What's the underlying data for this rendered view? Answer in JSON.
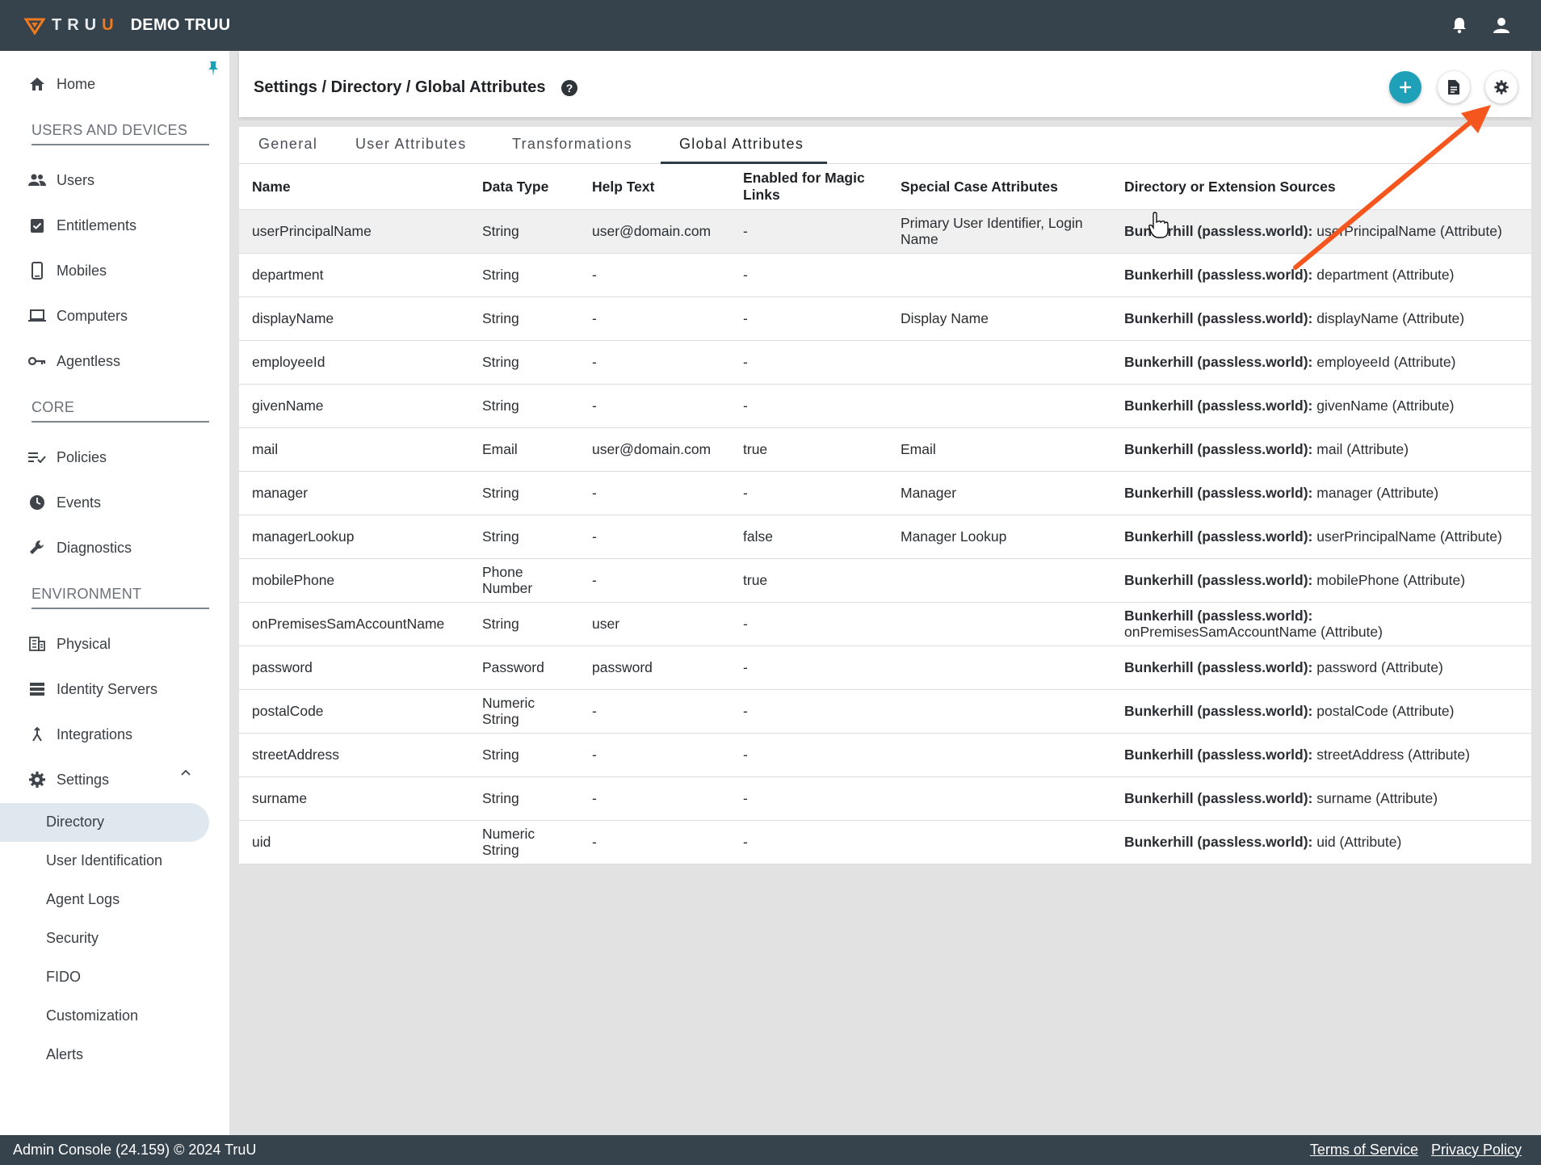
{
  "topbar": {
    "brand": "TRUU",
    "org_name": "DEMO TRUU",
    "icons": [
      "bell-icon",
      "account-icon"
    ]
  },
  "sidebar": {
    "items": [
      {
        "label": "Home",
        "icon": "home-icon"
      },
      {
        "label": "Users",
        "icon": "users-icon"
      },
      {
        "label": "Entitlements",
        "icon": "clipboard-check-icon"
      },
      {
        "label": "Mobiles",
        "icon": "phone-icon"
      },
      {
        "label": "Computers",
        "icon": "laptop-icon"
      },
      {
        "label": "Agentless",
        "icon": "key-icon"
      },
      {
        "label": "Policies",
        "icon": "list-check-icon"
      },
      {
        "label": "Events",
        "icon": "clock-icon"
      },
      {
        "label": "Diagnostics",
        "icon": "wrench-icon"
      },
      {
        "label": "Physical",
        "icon": "building-icon"
      },
      {
        "label": "Identity Servers",
        "icon": "server-icon"
      },
      {
        "label": "Integrations",
        "icon": "merge-icon"
      },
      {
        "label": "Settings",
        "icon": "gear-icon"
      }
    ],
    "sections": {
      "users_devices": "USERS AND DEVICES",
      "core": "CORE",
      "environment": "ENVIRONMENT"
    },
    "settings_sub": [
      "Directory",
      "User Identification",
      "Agent Logs",
      "Security",
      "FIDO",
      "Customization",
      "Alerts"
    ],
    "active_sub": "Directory"
  },
  "header": {
    "breadcrumb": "Settings / Directory / Global Attributes"
  },
  "tabs": [
    "General",
    "User Attributes",
    "Transformations",
    "Global Attributes"
  ],
  "active_tab": "Global Attributes",
  "table": {
    "headers": [
      "Name",
      "Data Type",
      "Help Text",
      "Enabled for Magic Links",
      "Special Case Attributes",
      "Directory or Extension Sources"
    ],
    "source_prefix": "Bunkerhill (passless.world):",
    "rows": [
      {
        "name": "userPrincipalName",
        "type": "String",
        "help": "user@domain.com",
        "magic": "-",
        "special": "Primary User Identifier, Login Name",
        "source": "userPrincipalName (Attribute)"
      },
      {
        "name": "department",
        "type": "String",
        "help": "-",
        "magic": "-",
        "special": "",
        "source": "department (Attribute)"
      },
      {
        "name": "displayName",
        "type": "String",
        "help": "-",
        "magic": "-",
        "special": "Display Name",
        "source": "displayName (Attribute)"
      },
      {
        "name": "employeeId",
        "type": "String",
        "help": "-",
        "magic": "-",
        "special": "",
        "source": "employeeId (Attribute)"
      },
      {
        "name": "givenName",
        "type": "String",
        "help": "-",
        "magic": "-",
        "special": "",
        "source": "givenName (Attribute)"
      },
      {
        "name": "mail",
        "type": "Email",
        "help": "user@domain.com",
        "magic": "true",
        "special": "Email",
        "source": "mail (Attribute)"
      },
      {
        "name": "manager",
        "type": "String",
        "help": "-",
        "magic": "-",
        "special": "Manager",
        "source": "manager (Attribute)"
      },
      {
        "name": "managerLookup",
        "type": "String",
        "help": "-",
        "magic": "false",
        "special": "Manager Lookup",
        "source": "userPrincipalName (Attribute)"
      },
      {
        "name": "mobilePhone",
        "type": "Phone Number",
        "help": "-",
        "magic": "true",
        "special": "",
        "source": "mobilePhone (Attribute)"
      },
      {
        "name": "onPremisesSamAccountName",
        "type": "String",
        "help": "user",
        "magic": "-",
        "special": "",
        "source": "onPremisesSamAccountName (Attribute)"
      },
      {
        "name": "password",
        "type": "Password",
        "help": "password",
        "magic": "-",
        "special": "",
        "source": "password (Attribute)"
      },
      {
        "name": "postalCode",
        "type": "Numeric String",
        "help": "-",
        "magic": "-",
        "special": "",
        "source": "postalCode (Attribute)"
      },
      {
        "name": "streetAddress",
        "type": "String",
        "help": "-",
        "magic": "-",
        "special": "",
        "source": "streetAddress (Attribute)"
      },
      {
        "name": "surname",
        "type": "String",
        "help": "-",
        "magic": "-",
        "special": "",
        "source": "surname (Attribute)"
      },
      {
        "name": "uid",
        "type": "Numeric String",
        "help": "-",
        "magic": "-",
        "special": "",
        "source": "uid (Attribute)"
      }
    ]
  },
  "footer": {
    "version": "Admin Console (24.159) © 2024 TruU",
    "terms": "Terms of Service",
    "privacy": "Privacy Policy"
  },
  "colors": {
    "topbar": "#36434d",
    "accent": "#1ea0b8",
    "brand_orange": "#f07a1d",
    "annotation_arrow": "#f4561d"
  }
}
